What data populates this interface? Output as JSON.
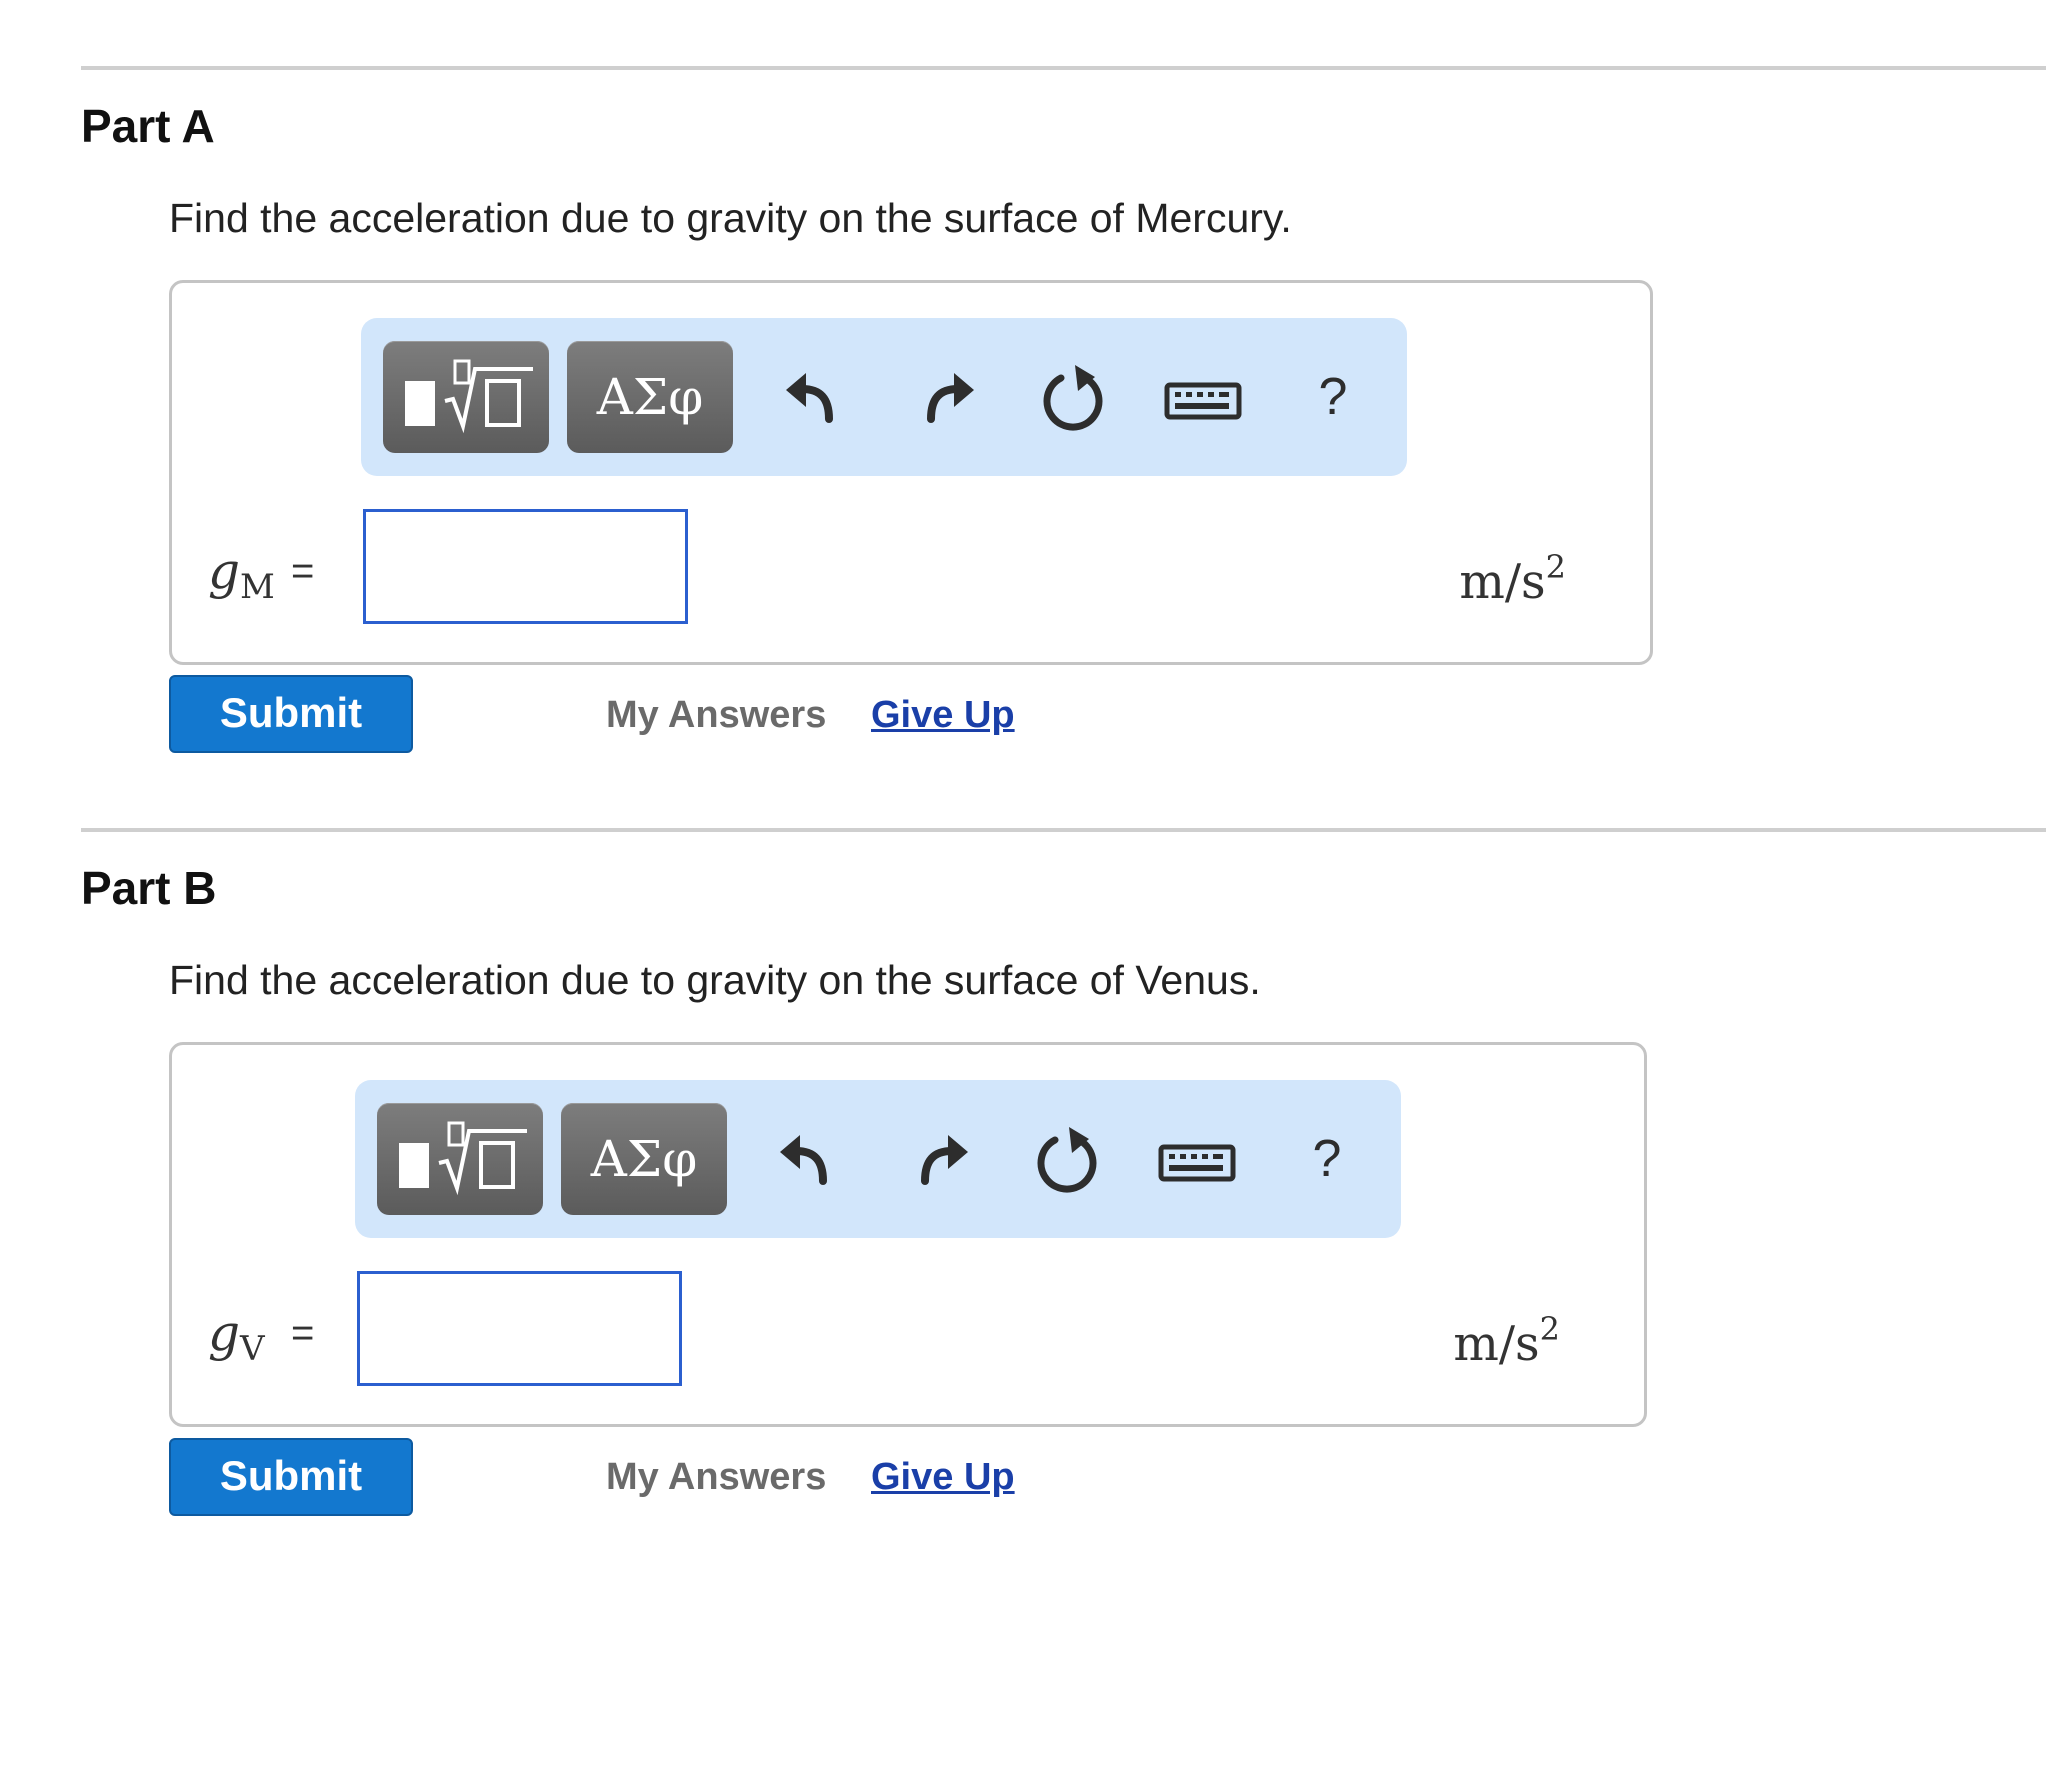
{
  "parts": [
    {
      "title": "Part A",
      "question": "Find the acceleration due to gravity on the surface of Mercury.",
      "variable": {
        "symbol": "g",
        "subscript": "M"
      },
      "equals": "=",
      "input_value": "",
      "units": {
        "base": "m/s",
        "exponent": "2"
      },
      "submit_label": "Submit",
      "my_answers_label": "My Answers",
      "give_up_label": "Give Up"
    },
    {
      "title": "Part B",
      "question": "Find the acceleration due to gravity on the surface of Venus.",
      "variable": {
        "symbol": "g",
        "subscript": "V"
      },
      "equals": "=",
      "input_value": "",
      "units": {
        "base": "m/s",
        "exponent": "2"
      },
      "submit_label": "Submit",
      "my_answers_label": "My Answers",
      "give_up_label": "Give Up"
    }
  ],
  "toolbar": {
    "greek_label": "ΑΣφ",
    "help_label": "?",
    "icons": [
      "templates-icon",
      "greek-letters-icon",
      "undo-icon",
      "redo-icon",
      "reset-icon",
      "keyboard-icon",
      "help-icon"
    ]
  },
  "colors": {
    "toolbar_bg": "#d2e6fb",
    "dark_button": "#6b6b6b",
    "submit_bg": "#1378cf",
    "input_border": "#2b5fcf",
    "link": "#1a3fa8",
    "divider": "#cfcfcf"
  }
}
